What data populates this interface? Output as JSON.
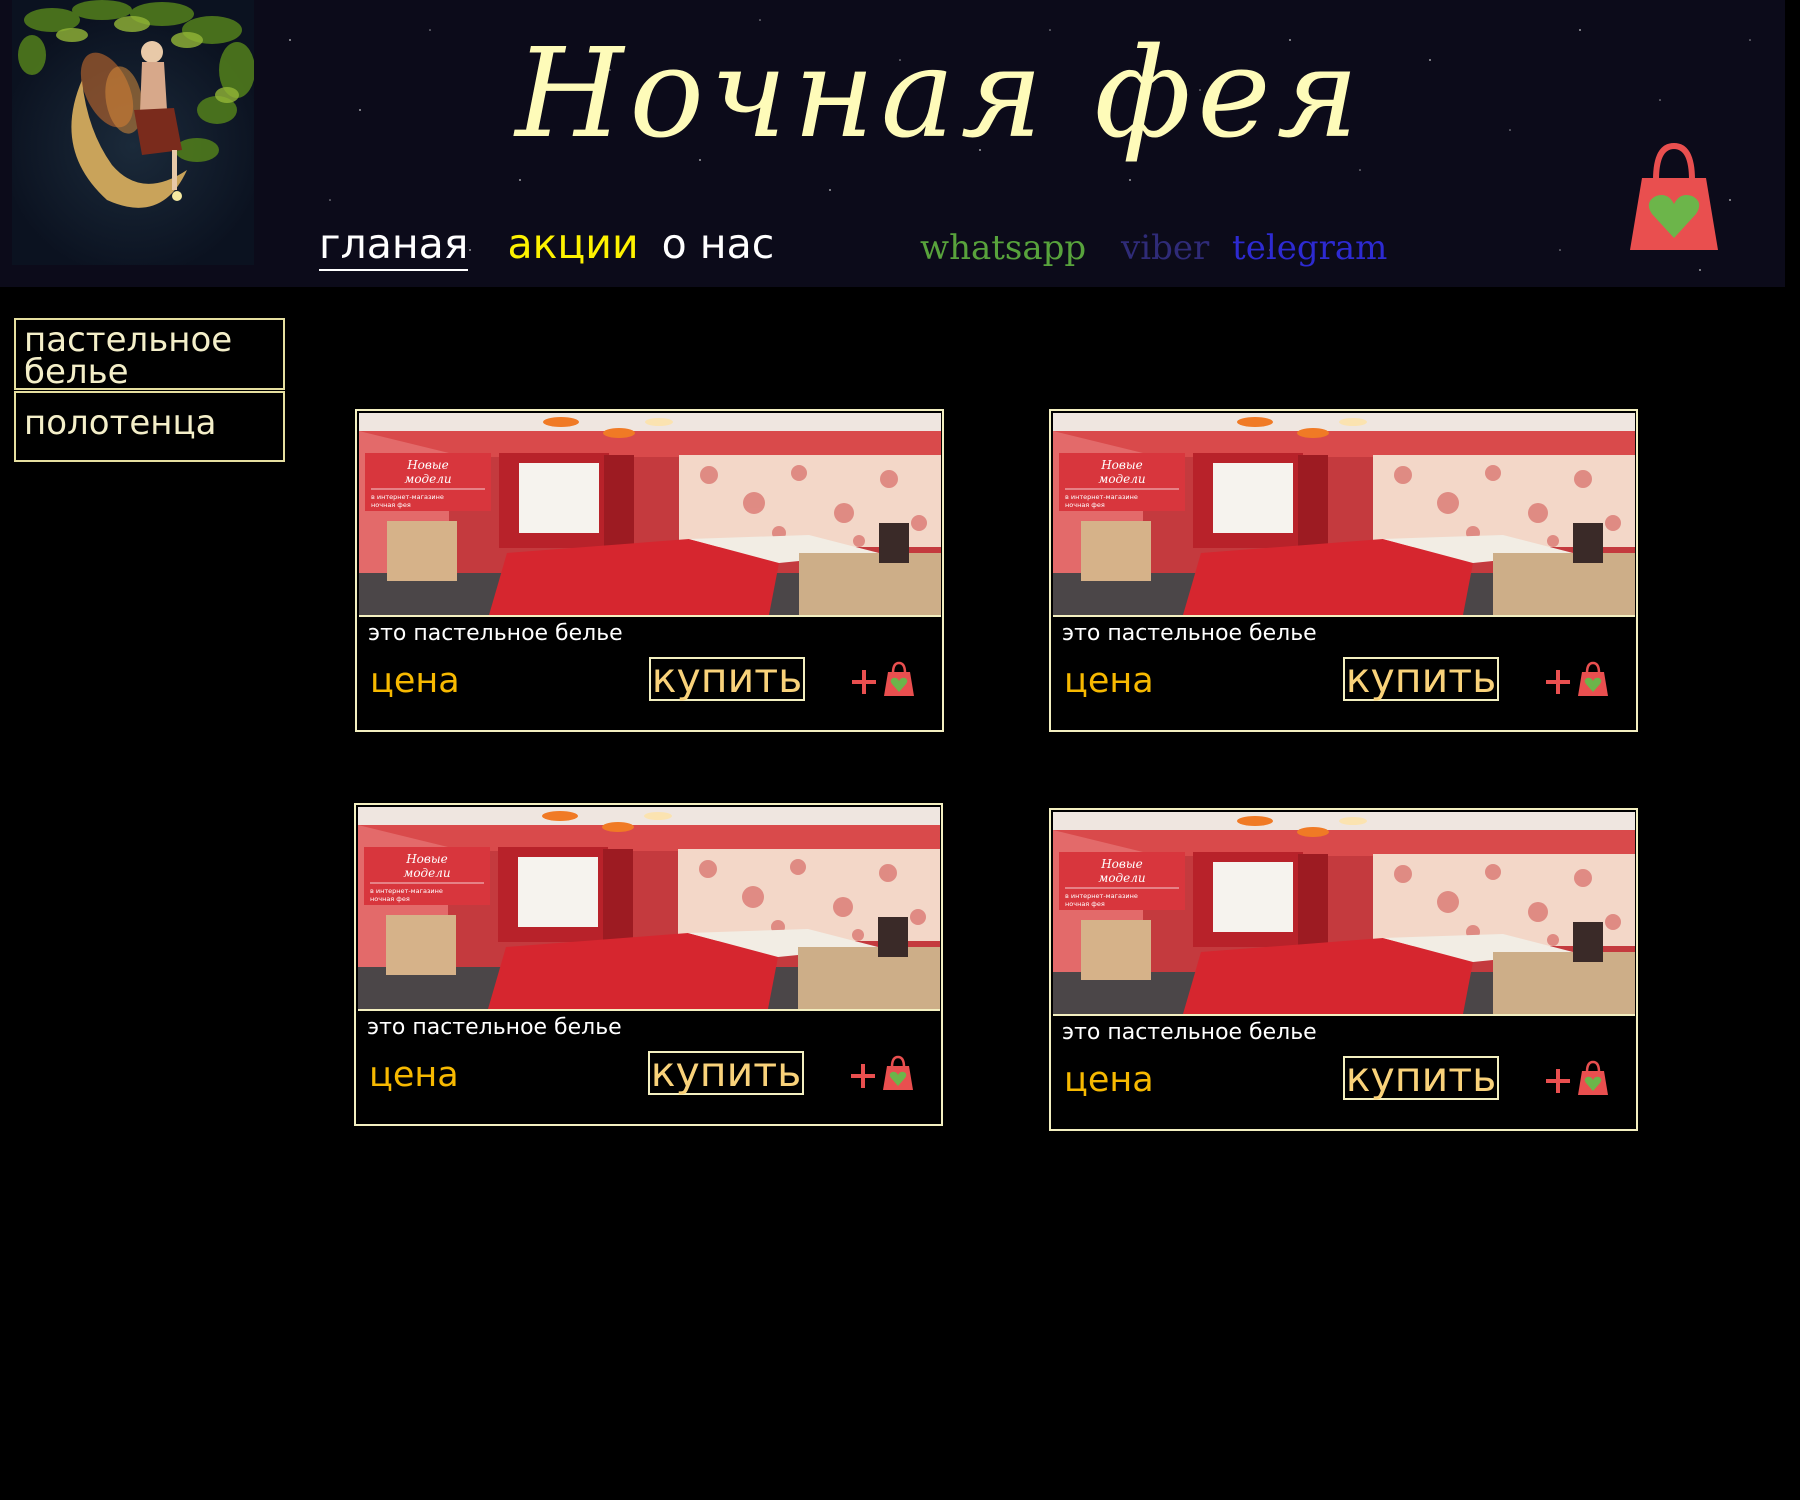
{
  "header": {
    "title": "Ночная фея",
    "nav": {
      "home": "гланая",
      "promotions": "акции",
      "about": "о нас"
    },
    "messengers": {
      "whatsapp": "whatsapp",
      "viber": "viber",
      "telegram": "telegram"
    },
    "cart_icon": "shopping-bag-heart-icon"
  },
  "sidebar": {
    "categories": [
      {
        "line1": "пастельное",
        "line2": "белье"
      },
      {
        "line1": "полотенца",
        "line2": ""
      }
    ]
  },
  "products": [
    {
      "description": "это пастельное белье",
      "price_label": "цена",
      "buy_label": "купить",
      "banner": {
        "line1": "Новые",
        "line2": "модели",
        "sub1": "в интернет-магазине",
        "sub2": "ночная фея"
      }
    },
    {
      "description": "это пастельное белье",
      "price_label": "цена",
      "buy_label": "купить",
      "banner": {
        "line1": "Новые",
        "line2": "модели",
        "sub1": "в интернет-магазине",
        "sub2": "ночная фея"
      }
    },
    {
      "description": "это пастельное белье",
      "price_label": "цена",
      "buy_label": "купить",
      "banner": {
        "line1": "Новые",
        "line2": "модели",
        "sub1": "в интернет-магазине",
        "sub2": "ночная фея"
      }
    },
    {
      "description": "это пастельное белье",
      "price_label": "цена",
      "buy_label": "купить",
      "banner": {
        "line1": "Новые",
        "line2": "модели",
        "sub1": "в интернет-магазине",
        "sub2": "ночная фея"
      }
    }
  ],
  "icons": {
    "add": "plus-icon",
    "bag": "shopping-bag-heart-icon"
  },
  "colors": {
    "page_background": "#000000",
    "header_background": "#0c0b1a",
    "title": "#fefbb9",
    "nav_promo": "#fef200",
    "whatsapp": "#58a33c",
    "viber": "#2f2b78",
    "telegram": "#2d2ad2",
    "price": "#f7b900",
    "buy_text": "#f9d27a",
    "border": "#f3efc0",
    "bag": "#e94f4f",
    "heart": "#6cb54a"
  }
}
